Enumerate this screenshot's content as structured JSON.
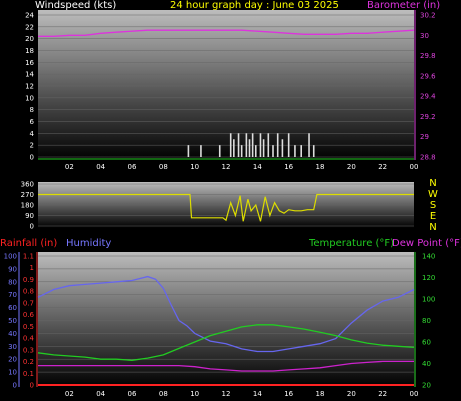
{
  "header": {
    "left_label": "Windspeed (kts)",
    "center_label": "24 hour graph day : June 03 2025",
    "right_label": "Barometer (in)"
  },
  "lower_labels": {
    "rainfall": "Rainfall (in)",
    "humidity": "Humidity",
    "temperature": "Temperature (°F)",
    "dewpoint": "Dew Point (°F)"
  },
  "colors": {
    "windspeed": "#dddddd",
    "gust": "#22cc22",
    "barometer": "#dd33dd",
    "direction": "#dddd00",
    "rainfall": "#ff2222",
    "humidity": "#6666ee",
    "temperature": "#22cc22",
    "dewpoint": "#cc22cc",
    "rain_axis": "#ff3333",
    "humidity_axis": "#7777ff",
    "temp_axis": "#33dd33",
    "baro_axis": "#dd44dd",
    "frame_bg": "#000000"
  },
  "chart_data": [
    {
      "type": "line",
      "name_ref": "wind-barometer",
      "xlim": [
        0,
        24
      ],
      "x_ticks": [
        "02",
        "04",
        "06",
        "08",
        "10",
        "12",
        "14",
        "16",
        "18",
        "20",
        "22",
        "00"
      ],
      "ylim_left": [
        0,
        24
      ],
      "y_ticks_left": [
        "0",
        "2",
        "4",
        "6",
        "8",
        "10",
        "12",
        "14",
        "16",
        "18",
        "20",
        "22",
        "24"
      ],
      "ylim_right": [
        28.8,
        30.2
      ],
      "y_ticks_right": [
        "28.8",
        "29",
        "29.2",
        "29.4",
        "29.6",
        "29.8",
        "30",
        "30.2"
      ],
      "series": [
        {
          "name": "Windspeed (kts)",
          "kind": "bars",
          "axis": "left",
          "x": [
            9.6,
            10.4,
            11.6,
            12.3,
            12.5,
            12.8,
            13.0,
            13.3,
            13.5,
            13.7,
            13.9,
            14.2,
            14.4,
            14.7,
            15.0,
            15.3,
            15.6,
            16.0,
            16.4,
            16.8,
            17.3,
            17.6
          ],
          "values": [
            2,
            2,
            2,
            4,
            3,
            4,
            2,
            4,
            3,
            4,
            2,
            4,
            3,
            4,
            2,
            4,
            3,
            4,
            2,
            2,
            4,
            2
          ]
        },
        {
          "name": "Barometer (in)",
          "kind": "line",
          "axis": "right",
          "x": [
            0,
            1,
            2,
            3,
            4,
            5,
            6,
            7,
            8,
            9,
            10,
            11,
            12,
            13,
            14,
            15,
            16,
            17,
            18,
            19,
            20,
            21,
            22,
            23,
            24
          ],
          "values": [
            29.99,
            29.99,
            30.0,
            30.0,
            30.02,
            30.03,
            30.04,
            30.05,
            30.05,
            30.05,
            30.05,
            30.05,
            30.05,
            30.05,
            30.04,
            30.03,
            30.02,
            30.01,
            30.01,
            30.01,
            30.02,
            30.02,
            30.03,
            30.04,
            30.05
          ]
        }
      ]
    },
    {
      "type": "line",
      "name_ref": "wind-direction",
      "xlim": [
        0,
        24
      ],
      "ylim": [
        0,
        360
      ],
      "y_ticks": [
        "0",
        "90",
        "180",
        "270",
        "360"
      ],
      "right_labels": [
        "N",
        "W",
        "S",
        "E",
        "N"
      ],
      "series": [
        {
          "name": "Wind direction",
          "axis": "left",
          "x": [
            0,
            9.7,
            9.8,
            10.0,
            11.0,
            11.8,
            12.0,
            12.3,
            12.6,
            12.9,
            13.1,
            13.4,
            13.6,
            13.9,
            14.2,
            14.5,
            14.8,
            15.1,
            15.4,
            15.7,
            16.0,
            16.4,
            16.8,
            17.2,
            17.6,
            17.8,
            18.0,
            24
          ],
          "values": [
            270,
            270,
            70,
            70,
            70,
            70,
            50,
            200,
            90,
            260,
            40,
            230,
            130,
            180,
            40,
            250,
            90,
            200,
            130,
            110,
            140,
            130,
            130,
            140,
            140,
            270,
            270,
            270
          ]
        }
      ]
    },
    {
      "type": "line",
      "name_ref": "rain-humidity-temp",
      "xlim": [
        0,
        24
      ],
      "x_ticks": [
        "02",
        "04",
        "06",
        "08",
        "10",
        "12",
        "14",
        "16",
        "18",
        "20",
        "22",
        "00"
      ],
      "ylim_rain": [
        0,
        1.1
      ],
      "y_ticks_rain": [
        "0",
        "0.1",
        "0.2",
        "0.3",
        "0.4",
        "0.5",
        "0.6",
        "0.7",
        "0.8",
        "0.9",
        "1",
        "1.1"
      ],
      "ylim_humidity": [
        0,
        100
      ],
      "y_ticks_humidity": [
        "0",
        "10",
        "20",
        "30",
        "40",
        "50",
        "60",
        "70",
        "80",
        "90",
        "100"
      ],
      "ylim_temp": [
        20,
        140
      ],
      "y_ticks_temp": [
        "20",
        "40",
        "60",
        "80",
        "100",
        "120",
        "140"
      ],
      "series": [
        {
          "name": "Rainfall (in)",
          "axis": "rain",
          "kind": "line",
          "x": [
            0,
            24
          ],
          "values": [
            0,
            0
          ]
        },
        {
          "name": "Humidity",
          "axis": "humidity",
          "kind": "line",
          "x": [
            0,
            1,
            2,
            3,
            4,
            5,
            6,
            7,
            7.5,
            8,
            8.5,
            9,
            9.5,
            10,
            11,
            12,
            13,
            14,
            15,
            16,
            17,
            18,
            19,
            20,
            21,
            22,
            23,
            24
          ],
          "values": [
            68,
            74,
            77,
            78,
            79,
            80,
            81,
            84,
            82,
            75,
            62,
            50,
            46,
            40,
            34,
            32,
            28,
            26,
            26,
            28,
            30,
            32,
            36,
            48,
            58,
            65,
            68,
            74
          ]
        },
        {
          "name": "Temperature (°F)",
          "axis": "temp",
          "kind": "line",
          "x": [
            0,
            1,
            2,
            3,
            4,
            5,
            6,
            7,
            8,
            9,
            10,
            11,
            12,
            13,
            14,
            15,
            16,
            17,
            18,
            19,
            20,
            21,
            22,
            23,
            24
          ],
          "values": [
            50,
            48,
            47,
            46,
            44,
            44,
            43,
            45,
            48,
            54,
            60,
            66,
            70,
            74,
            76,
            76,
            74,
            72,
            69,
            66,
            62,
            59,
            57,
            56,
            55
          ]
        },
        {
          "name": "Dew Point (°F)",
          "axis": "temp",
          "kind": "line",
          "x": [
            0,
            1,
            2,
            3,
            4,
            5,
            6,
            7,
            8,
            9,
            10,
            11,
            12,
            13,
            14,
            15,
            16,
            17,
            18,
            19,
            20,
            21,
            22,
            23,
            24
          ],
          "values": [
            38,
            38,
            38,
            38,
            38,
            38,
            38,
            38,
            38,
            38,
            37,
            35,
            34,
            33,
            33,
            33,
            34,
            35,
            36,
            38,
            40,
            41,
            42,
            42,
            42
          ]
        }
      ]
    }
  ]
}
